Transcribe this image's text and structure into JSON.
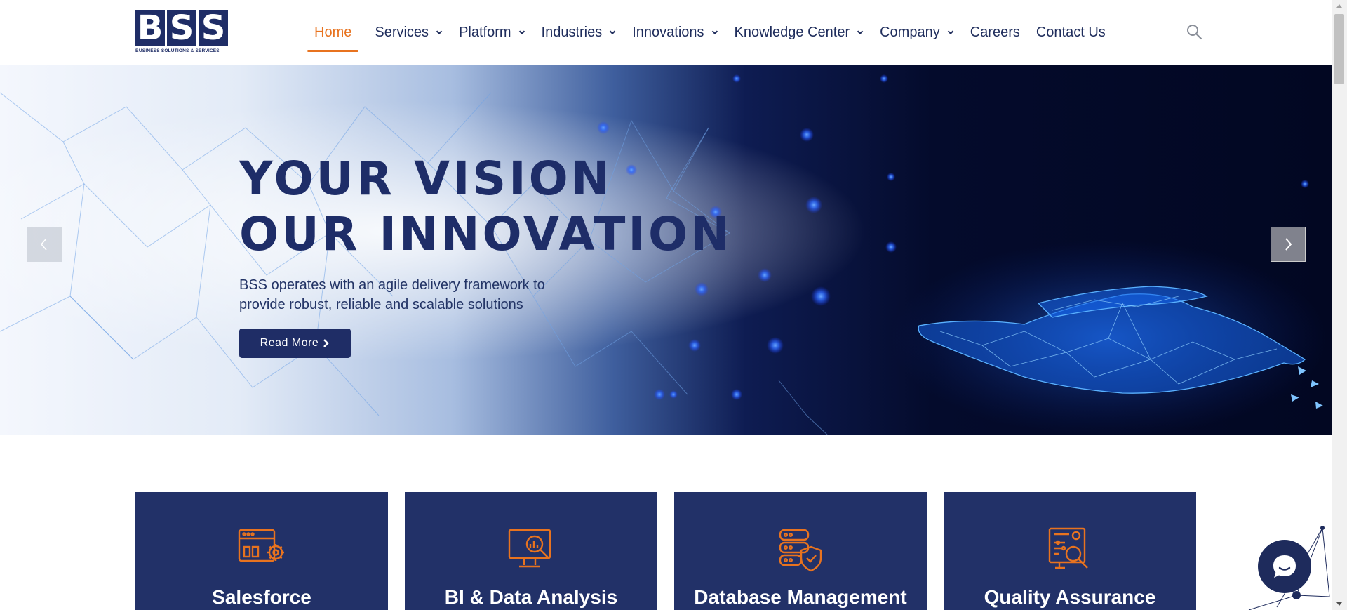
{
  "brand": {
    "logo_letters": [
      "B",
      "S",
      "S"
    ],
    "logo_tagline": "BUSINESS SOLUTIONS & SERVICES",
    "primary_color": "#1f2d66",
    "accent_color": "#e8731f"
  },
  "nav": {
    "items": [
      {
        "label": "Home",
        "active": true,
        "has_dropdown": false
      },
      {
        "label": "Services",
        "has_dropdown": true
      },
      {
        "label": "Platform",
        "has_dropdown": true
      },
      {
        "label": "Industries",
        "has_dropdown": true
      },
      {
        "label": "Innovations",
        "has_dropdown": true
      },
      {
        "label": "Knowledge Center",
        "has_dropdown": true
      },
      {
        "label": "Company",
        "has_dropdown": true
      },
      {
        "label": "Careers",
        "has_dropdown": false
      },
      {
        "label": "Contact Us",
        "has_dropdown": false
      }
    ],
    "search_icon": "search-icon"
  },
  "hero": {
    "title_line1": "YOUR VISION",
    "title_line2": "OUR INNOVATION",
    "subtitle_line1": "BSS operates with an agile delivery framework to",
    "subtitle_line2": "provide robust, reliable and scalable solutions",
    "cta_label": "Read More",
    "prev_icon": "chevron-left-icon",
    "next_icon": "chevron-right-icon"
  },
  "cards": [
    {
      "title": "Salesforce",
      "icon": "salesforce-settings-icon"
    },
    {
      "title": "BI & Data Analysis",
      "icon": "data-analysis-monitor-icon"
    },
    {
      "title": "Database Management",
      "icon": "database-shield-icon"
    },
    {
      "title": "Quality Assurance",
      "icon": "quality-assurance-report-icon"
    }
  ],
  "chat": {
    "icon": "chat-bubble-icon"
  }
}
